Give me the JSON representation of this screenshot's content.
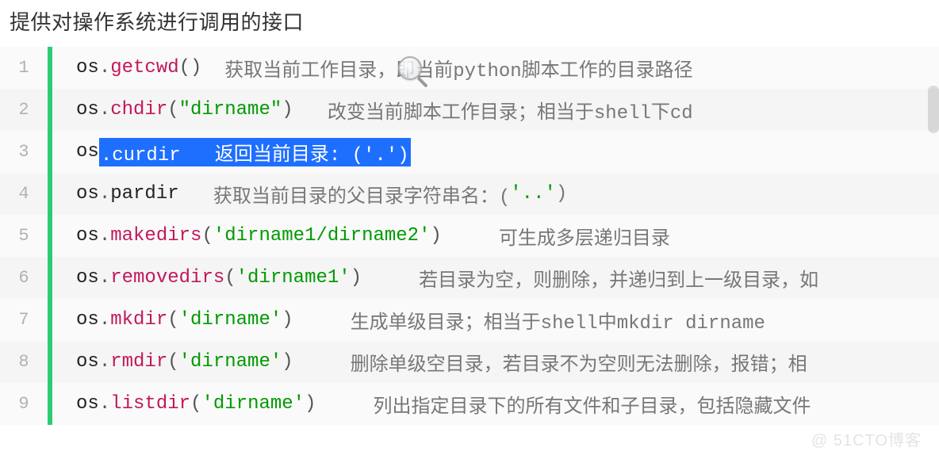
{
  "heading": "提供对操作系统进行调用的接口",
  "watermark": "@ 51CTO博客",
  "lines": [
    {
      "num": "1",
      "tokens": [
        {
          "cls": "tok-plain",
          "t": "os"
        },
        {
          "cls": "tok-punct",
          "t": "."
        },
        {
          "cls": "tok-func",
          "t": "getcwd"
        },
        {
          "cls": "tok-punct",
          "t": "()"
        },
        {
          "cls": "tok-plain",
          "t": "  "
        },
        {
          "cls": "tok-cmt",
          "t": "获取当前工作目录，即当前python脚本工作的目录路径"
        }
      ]
    },
    {
      "num": "2",
      "tokens": [
        {
          "cls": "tok-plain",
          "t": "os"
        },
        {
          "cls": "tok-punct",
          "t": "."
        },
        {
          "cls": "tok-func",
          "t": "chdir"
        },
        {
          "cls": "tok-punct",
          "t": "("
        },
        {
          "cls": "tok-str",
          "t": "\"dirname\""
        },
        {
          "cls": "tok-punct",
          "t": ")"
        },
        {
          "cls": "tok-plain",
          "t": "   "
        },
        {
          "cls": "tok-cmt",
          "t": "改变当前脚本工作目录；相当于shell下cd"
        }
      ]
    },
    {
      "num": "3",
      "tokens": [
        {
          "cls": "tok-plain",
          "t": "os"
        },
        {
          "cls": "tok-sel",
          "t": ".curdir   返回当前目录: ('.')"
        }
      ]
    },
    {
      "num": "4",
      "tokens": [
        {
          "cls": "tok-plain",
          "t": "os"
        },
        {
          "cls": "tok-punct",
          "t": "."
        },
        {
          "cls": "tok-plain",
          "t": "pardir"
        },
        {
          "cls": "tok-plain",
          "t": "   "
        },
        {
          "cls": "tok-cmt",
          "t": "获取当前目录的父目录字符串名：("
        },
        {
          "cls": "tok-str",
          "t": "'..'"
        },
        {
          "cls": "tok-cmt",
          "t": ")"
        }
      ]
    },
    {
      "num": "5",
      "tokens": [
        {
          "cls": "tok-plain",
          "t": "os"
        },
        {
          "cls": "tok-punct",
          "t": "."
        },
        {
          "cls": "tok-func",
          "t": "makedirs"
        },
        {
          "cls": "tok-punct",
          "t": "("
        },
        {
          "cls": "tok-str",
          "t": "'dirname1/dirname2'"
        },
        {
          "cls": "tok-punct",
          "t": ")"
        },
        {
          "cls": "tok-plain",
          "t": "     "
        },
        {
          "cls": "tok-cmt",
          "t": "可生成多层递归目录"
        }
      ]
    },
    {
      "num": "6",
      "tokens": [
        {
          "cls": "tok-plain",
          "t": "os"
        },
        {
          "cls": "tok-punct",
          "t": "."
        },
        {
          "cls": "tok-func",
          "t": "removedirs"
        },
        {
          "cls": "tok-punct",
          "t": "("
        },
        {
          "cls": "tok-str",
          "t": "'dirname1'"
        },
        {
          "cls": "tok-punct",
          "t": ")"
        },
        {
          "cls": "tok-plain",
          "t": "     "
        },
        {
          "cls": "tok-cmt",
          "t": "若目录为空，则删除，并递归到上一级目录，如"
        }
      ]
    },
    {
      "num": "7",
      "tokens": [
        {
          "cls": "tok-plain",
          "t": "os"
        },
        {
          "cls": "tok-punct",
          "t": "."
        },
        {
          "cls": "tok-func",
          "t": "mkdir"
        },
        {
          "cls": "tok-punct",
          "t": "("
        },
        {
          "cls": "tok-str",
          "t": "'dirname'"
        },
        {
          "cls": "tok-punct",
          "t": ")"
        },
        {
          "cls": "tok-plain",
          "t": "     "
        },
        {
          "cls": "tok-cmt",
          "t": "生成单级目录；相当于shell中mkdir dirname"
        }
      ]
    },
    {
      "num": "8",
      "tokens": [
        {
          "cls": "tok-plain",
          "t": "os"
        },
        {
          "cls": "tok-punct",
          "t": "."
        },
        {
          "cls": "tok-func",
          "t": "rmdir"
        },
        {
          "cls": "tok-punct",
          "t": "("
        },
        {
          "cls": "tok-str",
          "t": "'dirname'"
        },
        {
          "cls": "tok-punct",
          "t": ")"
        },
        {
          "cls": "tok-plain",
          "t": "     "
        },
        {
          "cls": "tok-cmt",
          "t": "删除单级空目录，若目录不为空则无法删除，报错；相"
        }
      ]
    },
    {
      "num": "9",
      "tokens": [
        {
          "cls": "tok-plain",
          "t": "os"
        },
        {
          "cls": "tok-punct",
          "t": "."
        },
        {
          "cls": "tok-func",
          "t": "listdir"
        },
        {
          "cls": "tok-punct",
          "t": "("
        },
        {
          "cls": "tok-str",
          "t": "'dirname'"
        },
        {
          "cls": "tok-punct",
          "t": ")"
        },
        {
          "cls": "tok-plain",
          "t": "     "
        },
        {
          "cls": "tok-cmt",
          "t": "列出指定目录下的所有文件和子目录，包括隐藏文件"
        }
      ]
    }
  ]
}
